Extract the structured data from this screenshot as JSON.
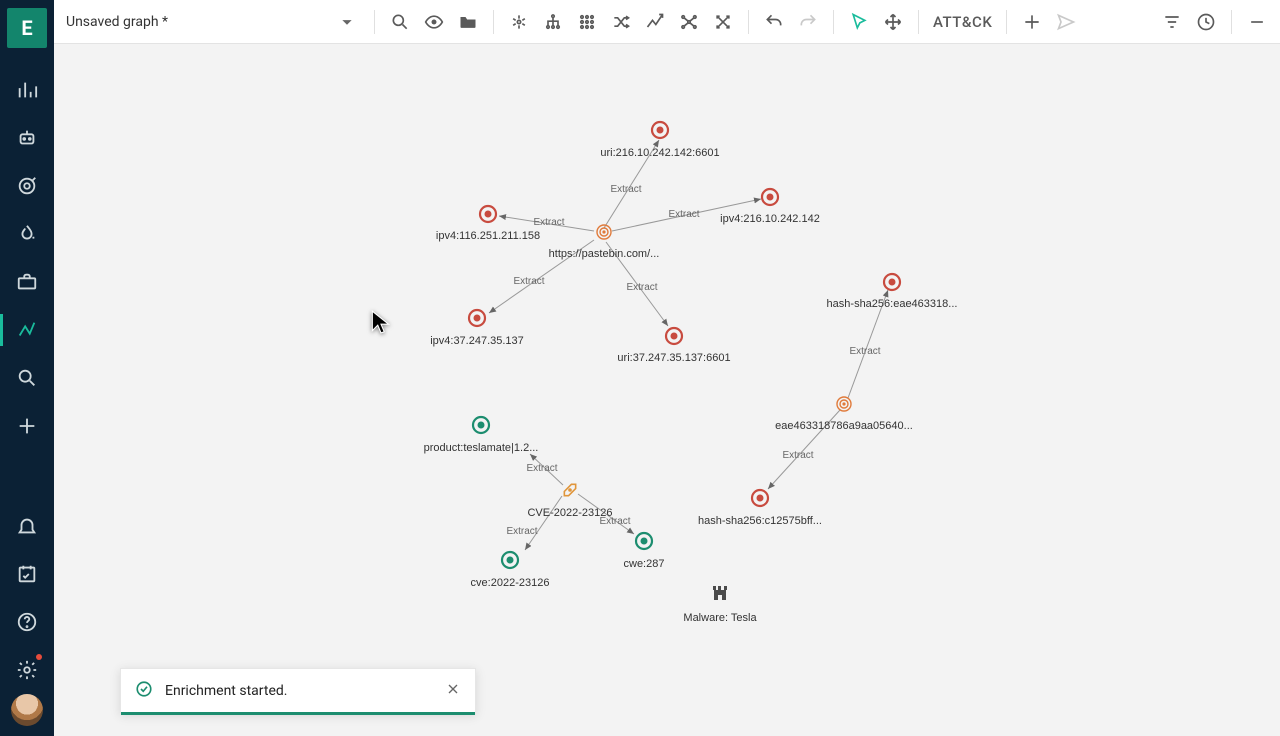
{
  "brand_letter": "E",
  "header": {
    "title": "Unsaved graph *",
    "attack_label": "ATT&CK"
  },
  "toast": {
    "message": "Enrichment started."
  },
  "nodes": {
    "n1": {
      "label": "uri:216.10.242.142:6601"
    },
    "n2": {
      "label": "ipv4:216.10.242.142"
    },
    "n3": {
      "label": "ipv4:116.251.211.158"
    },
    "n4": {
      "label": "https://pastebin.com/..."
    },
    "n5": {
      "label": "ipv4:37.247.35.137"
    },
    "n6": {
      "label": "uri:37.247.35.137:6601"
    },
    "n7": {
      "label": "hash-sha256:eae463318..."
    },
    "n8": {
      "label": "eae463318786a9aa05640..."
    },
    "n9": {
      "label": "hash-sha256:c12575bff..."
    },
    "n10": {
      "label": "product:teslamate|1.2..."
    },
    "n11": {
      "label": "CVE-2022-23126"
    },
    "n12": {
      "label": "cve:2022-23126"
    },
    "n13": {
      "label": "cwe:287"
    },
    "n14": {
      "label": "Malware: Tesla"
    }
  },
  "edges": {
    "e1": "Extract",
    "e2": "Extract",
    "e3": "Extract",
    "e4": "Extract",
    "e5": "Extract",
    "e6": "Extract",
    "e7": "Extract",
    "e8": "Extract",
    "e9": "Extract",
    "e10": "Extract"
  }
}
